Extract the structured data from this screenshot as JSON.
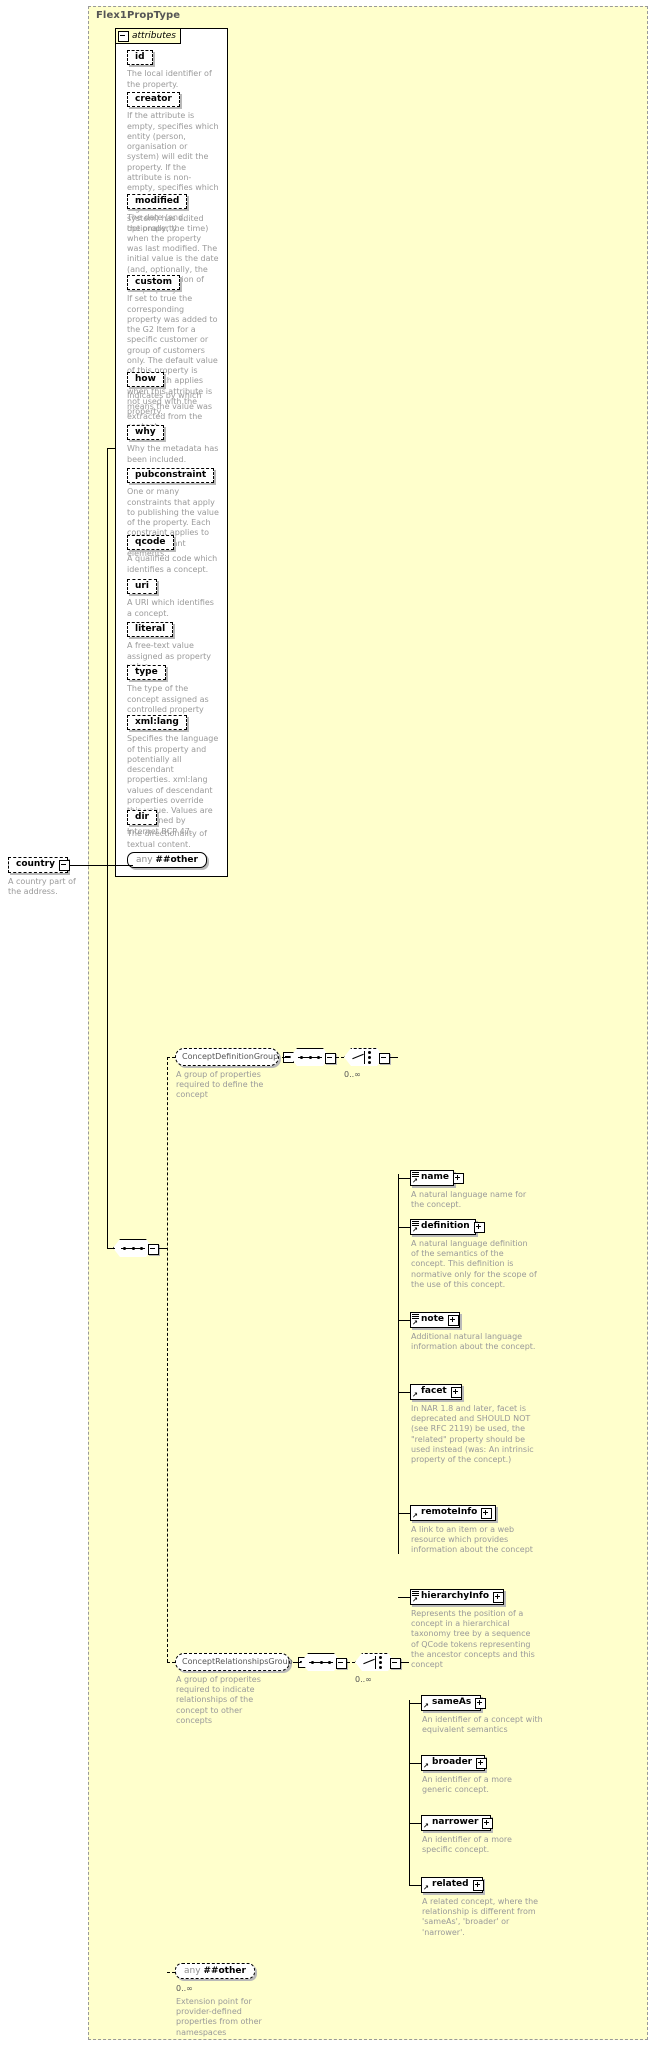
{
  "diagram": {
    "type_title": "Flex1PropType",
    "attributes_label": "attributes",
    "cardinality_def": "0..∞",
    "cardinality_rel": "0..∞",
    "cardinality_any": "0..∞"
  },
  "attributes": [
    {
      "name": "id",
      "desc": "The local identifier of the property."
    },
    {
      "name": "creator",
      "desc": "If the attribute is empty, specifies which entity (person, organisation or system) will edit the property. If the attribute is non-empty, specifies which entity (person, organisation or system) has edited the property."
    },
    {
      "name": "modified",
      "desc": "The date (and, optionally, the time) when the property was last modified. The initial value is the date (and, optionally, the time) of creation of the property."
    },
    {
      "name": "custom",
      "desc": "If set to true the corresponding property was added to the G2 Item for a specific customer or group of customers only. The default value of this property is false which applies when this attribute is not used with the property."
    },
    {
      "name": "how",
      "desc": "Indicates by which means the value was extracted from the content."
    },
    {
      "name": "why",
      "desc": "Why the metadata has been included."
    },
    {
      "name": "pubconstraint",
      "desc": "One or many constraints that apply to publishing the value of the property. Each constraint applies to all descendant elements."
    },
    {
      "name": "qcode",
      "desc": "A qualified code which identifies a concept."
    },
    {
      "name": "uri",
      "desc": "A URI which identifies a concept."
    },
    {
      "name": "literal",
      "desc": "A free-text value assigned as property value."
    },
    {
      "name": "type",
      "desc": "The type of the concept assigned as controlled property value."
    },
    {
      "name": "xml:lang",
      "desc": "Specifies the language of this property and potentially all descendant properties. xml:lang values of descendant properties override this value. Values are determined by Internet BCP 47."
    },
    {
      "name": "dir",
      "desc": "The directionality of textual content."
    }
  ],
  "attributes_any": {
    "prefix": "any",
    "name": "##other"
  },
  "country_element": {
    "name": "country",
    "desc": "A country part of the address."
  },
  "groups": [
    {
      "name": "ConceptDefinitionGroup",
      "desc": "A group of properties required to define the concept",
      "members": [
        {
          "name": "name",
          "desc": "A natural language name for the concept."
        },
        {
          "name": "definition",
          "desc": "A natural language definition of the semantics of the concept. This definition is normative only for the scope of the use of this concept."
        },
        {
          "name": "note",
          "desc": "Additional natural language information about the concept."
        },
        {
          "name": "facet",
          "desc": "In NAR 1.8 and later, facet is deprecated and SHOULD NOT (see RFC 2119) be used, the \"related\" property should be used instead (was: An intrinsic property of the concept.)"
        },
        {
          "name": "remoteInfo",
          "desc": "A link to an item or a web resource which provides information about the concept"
        },
        {
          "name": "hierarchyInfo",
          "desc": "Represents the position of a concept in a hierarchical taxonomy tree by a sequence of QCode tokens representing the ancestor concepts and this concept"
        }
      ]
    },
    {
      "name": "ConceptRelationshipsGroup",
      "desc": "A group of properites required to indicate relationships of the concept to other concepts",
      "members": [
        {
          "name": "sameAs",
          "desc": "An identifier of a concept with equivalent semantics"
        },
        {
          "name": "broader",
          "desc": "An identifier of a more generic concept."
        },
        {
          "name": "narrower",
          "desc": "An identifier of a more specific concept."
        },
        {
          "name": "related",
          "desc": "A related concept, where the relationship is different from 'sameAs', 'broader' or 'narrower'."
        }
      ]
    }
  ],
  "extension_any": {
    "prefix": "any",
    "name": "##other",
    "desc": "Extension point for provider-defined properties from other namespaces"
  }
}
